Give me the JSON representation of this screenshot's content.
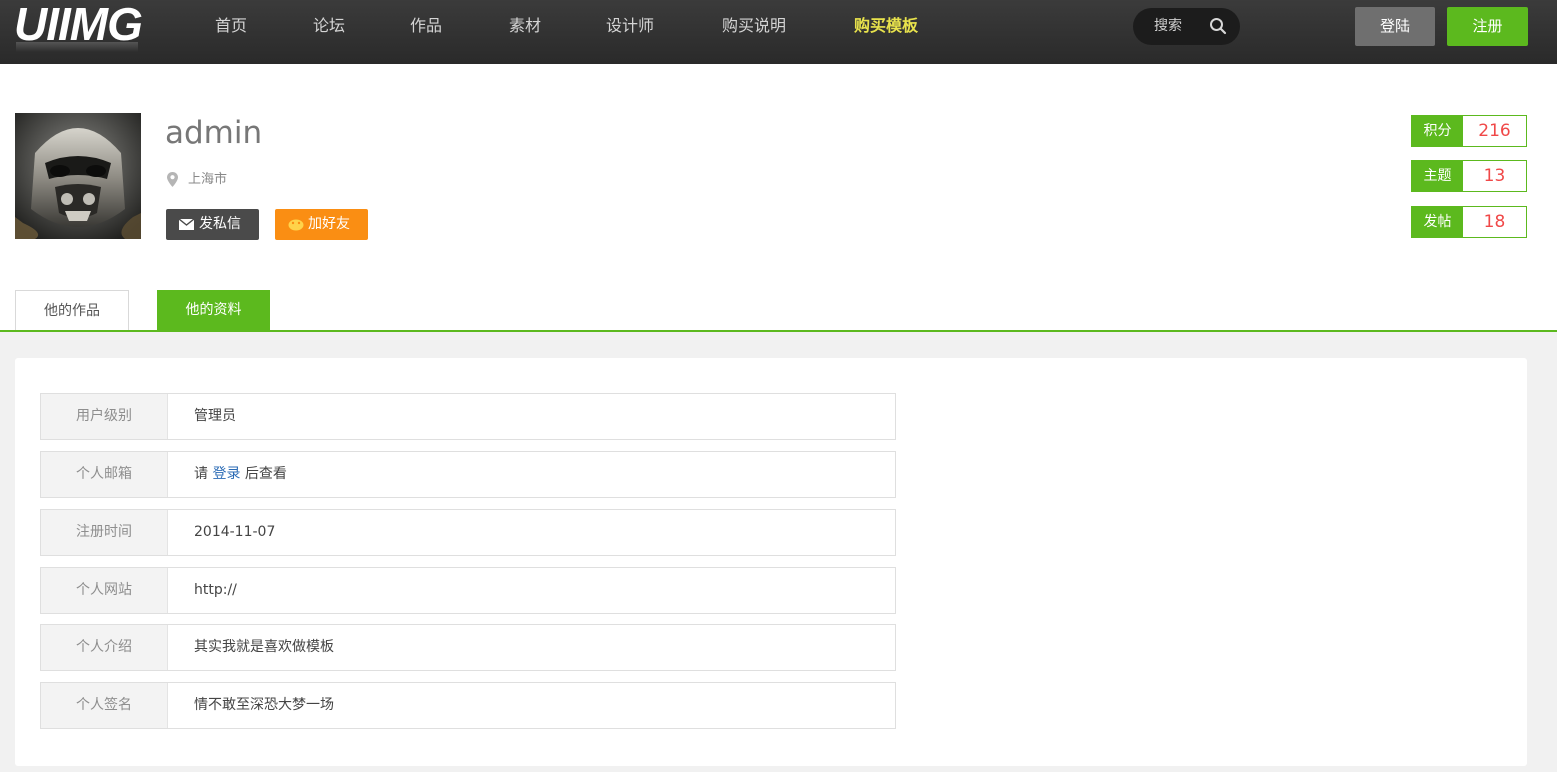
{
  "header": {
    "logo": "UIIMG",
    "nav": [
      "首页",
      "论坛",
      "作品",
      "素材",
      "设计师",
      "购买说明",
      "购买模板"
    ],
    "active_nav": "购买模板",
    "search_placeholder": "搜索",
    "login_label": "登陆",
    "register_label": "注册"
  },
  "profile": {
    "username": "admin",
    "location": "上海市",
    "message_button": "发私信",
    "add_friend_button": "加好友",
    "stats": [
      {
        "label": "积分",
        "value": "216"
      },
      {
        "label": "主题",
        "value": "13"
      },
      {
        "label": "发帖",
        "value": "18"
      }
    ]
  },
  "tabs": [
    {
      "label": "他的作品",
      "active": false
    },
    {
      "label": "他的资料",
      "active": true
    }
  ],
  "details": {
    "level": {
      "label": "用户级别",
      "value": "管理员"
    },
    "email": {
      "label": "个人邮箱",
      "prefix": "请",
      "link": "登录",
      "suffix": "后查看"
    },
    "register_time": {
      "label": "注册时间",
      "value": "2014-11-07"
    },
    "website": {
      "label": "个人网站",
      "value": "http://"
    },
    "intro": {
      "label": "个人介绍",
      "value": "其实我就是喜欢做模板"
    },
    "signature": {
      "label": "个人签名",
      "value": "情不敢至深恐大梦一场"
    }
  },
  "colors": {
    "brand_green": "#5cb91e",
    "nav_active": "#e8e24c",
    "stat_value": "#f04848",
    "friend_button": "#fa8e13",
    "link": "#2b6bb5"
  },
  "icons": [
    "search-icon",
    "location-pin-icon",
    "envelope-icon",
    "friend-icon"
  ]
}
